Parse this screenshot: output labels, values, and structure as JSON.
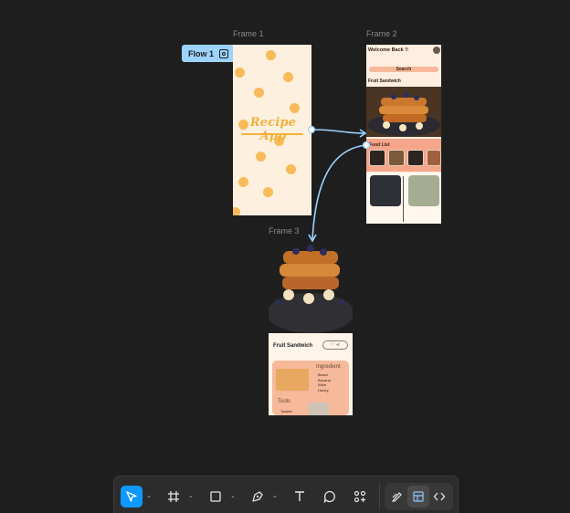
{
  "canvas": {
    "frames": [
      {
        "label": "Frame 1"
      },
      {
        "label": "Frame 2"
      },
      {
        "label": "Frame 3"
      }
    ],
    "flow_badge": {
      "label": "Flow 1"
    }
  },
  "frame1": {
    "app_title": "Recipe App"
  },
  "frame2": {
    "welcome": "Welcome Back !!",
    "search": "Search",
    "fruit_sandwich": "Fruit Sandwich",
    "food_list": "Food List"
  },
  "frame3": {
    "title": "Fruit Sandwich",
    "ingredient_heading": "Ingredient",
    "ingredients": [
      "Bread",
      "Banana",
      "Wine",
      "Honey"
    ],
    "tools_heading": "Tools",
    "tools": [
      "Toaster"
    ]
  },
  "toolbar": {
    "tools": [
      "move-tool",
      "frame-tool",
      "shape-tool",
      "pen-tool",
      "text-tool",
      "comment-tool",
      "actions-tool"
    ],
    "modes": [
      "draw-mode",
      "design-mode",
      "dev-mode"
    ],
    "active_tool": "move-tool",
    "active_mode": "design-mode",
    "accent": "#0d99ff"
  }
}
